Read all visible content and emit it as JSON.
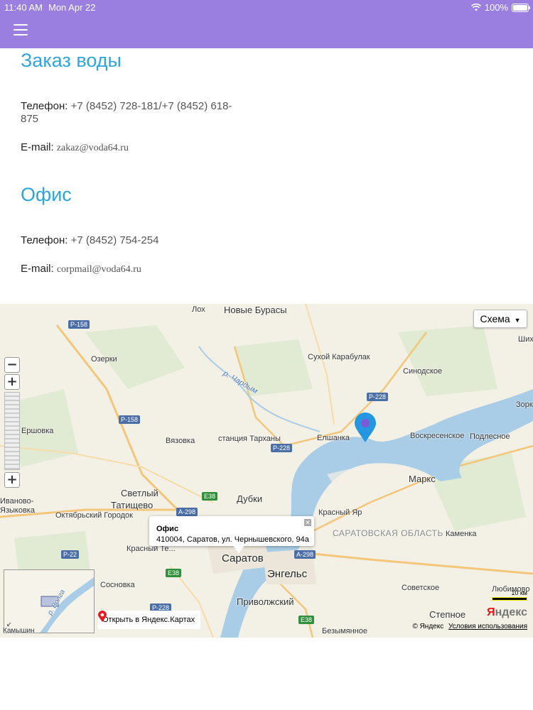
{
  "status_bar": {
    "time": "11:40 AM",
    "date": "Mon Apr 22",
    "battery": "100%"
  },
  "colors": {
    "header": "#9a7fe0",
    "title": "#2ea5dc",
    "water": "#a9cde6"
  },
  "sections": [
    {
      "title": "Заказ воды",
      "phone_label": "Телефон:",
      "phone_value": "+7 (8452) 728-181/+7 (8452) 618-875",
      "email_label": "E-mail:",
      "email_value": "zakaz@voda64.ru"
    },
    {
      "title": "Офис",
      "phone_label": "Телефон:",
      "phone_value": "+7 (8452) 754-254",
      "email_label": "E-mail:",
      "email_value": "corpmail@voda64.ru"
    }
  ],
  "map": {
    "scheme_label": "Схема",
    "balloon_title": "Офис",
    "balloon_address": "410004, Саратов, ул. Чернышевского, 94а",
    "open_link": "Открыть в Яндекс.Картах",
    "copyright": "© Яндекс",
    "terms": "Условия использования",
    "logo": "Яндекс",
    "scale": "10 км",
    "places": {
      "lokh": "Лох",
      "novye_burasy": "Новые Бурасы",
      "ozerki": "Озерки",
      "sukhoy": "Сухой Карабулак",
      "sinodskoe": "Синодское",
      "zork": "Зорк",
      "vyazovka": "Вязовка",
      "ershovka": "Ершовка",
      "tarkhany": "станция Тарханы",
      "elshanka": "Елшанка",
      "voskresenskoe": "Воскресенское",
      "podlesnoe": "Подлесное",
      "marks": "Маркс",
      "svetly": "Светлый",
      "tatishchevo": "Татищево",
      "dubki": "Дубки",
      "ivanovo": "Иваново-Языковка",
      "oktyabrsky": "Октябрьский Городок",
      "krasny_yar": "Красный Яр",
      "region": "САРАТОВСКАЯ ОБЛАСТЬ",
      "kamenka": "Каменка",
      "krasny_tekst": "Красный Те...",
      "saratov": "Саратов",
      "engels": "Энгельс",
      "sosnovka": "Сосновка",
      "sovetskoe": "Советское",
      "lyubimovo": "Любимово",
      "privolzhsky": "Приволжский",
      "stepnoe": "Степное",
      "bezymyannoe": "Безымянное",
      "shikh": "Шихо",
      "river_chardym": "р. Чардым",
      "river_volga": "р. Волга",
      "kamyshin": "Камышин"
    },
    "roads": {
      "r158a": "Р-158",
      "r158b": "Р-158",
      "r228a": "Р-228",
      "r228b": "Р-228",
      "r228c": "Р-228",
      "r298a": "А-298",
      "r298b": "А-298",
      "e38a": "E38",
      "e38b": "E38",
      "e38c": "E38",
      "r22": "Р-22"
    }
  }
}
